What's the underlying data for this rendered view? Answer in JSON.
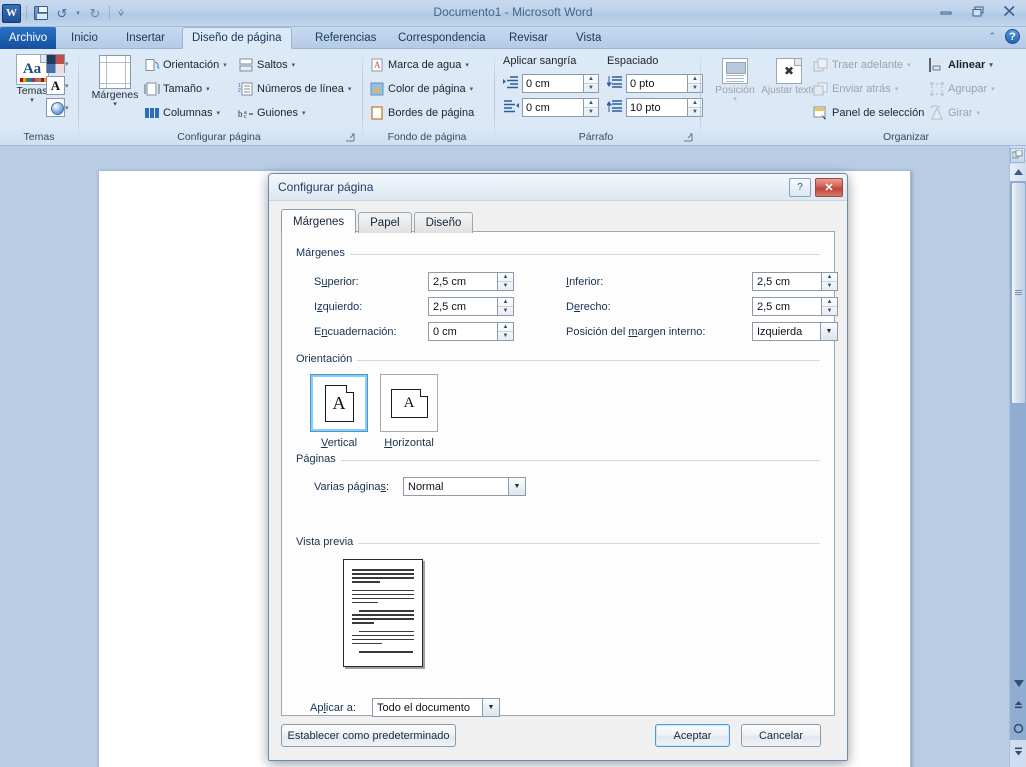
{
  "window": {
    "title": "Documento1 - Microsoft Word",
    "quick_access": {
      "word_logo": "W",
      "save": "save-icon",
      "undo": "undo-icon",
      "redo": "redo-icon",
      "customize": "customize-qat-icon"
    },
    "controls": {
      "minimize": "minimize",
      "restore": "restore",
      "close": "close"
    }
  },
  "tabs": {
    "file": "Archivo",
    "items": [
      {
        "label": "Inicio",
        "active": false
      },
      {
        "label": "Insertar",
        "active": false
      },
      {
        "label": "Diseño de página",
        "active": true
      },
      {
        "label": "Referencias",
        "active": false
      },
      {
        "label": "Correspondencia",
        "active": false
      },
      {
        "label": "Revisar",
        "active": false
      },
      {
        "label": "Vista",
        "active": false
      }
    ],
    "collapse_ribbon": "collapse-ribbon-icon",
    "help": "?"
  },
  "ribbon": {
    "groups": [
      {
        "name": "Temas",
        "label": "Temas",
        "big_button": "Temas",
        "small_buttons": [
          "Colores del tema",
          "Fuentes del tema",
          "Efectos del tema"
        ]
      },
      {
        "name": "Configurar página",
        "label": "Configurar página",
        "big_button": "Márgenes",
        "commands": [
          "Orientación",
          "Saltos",
          "Tamaño",
          "Números de línea",
          "Columnas",
          "Guiones"
        ]
      },
      {
        "name": "Fondo de página",
        "label": "Fondo de página",
        "commands": [
          "Marca de agua",
          "Color de página",
          "Bordes de página"
        ]
      },
      {
        "name": "Párrafo",
        "label": "Párrafo",
        "indent_title": "Aplicar sangría",
        "spacing_title": "Espaciado",
        "indent_left": "0 cm",
        "indent_right": "0 cm",
        "spacing_before": "0 pto",
        "spacing_after": "10 pto"
      },
      {
        "name": "Organizar",
        "label": "Organizar",
        "big_buttons": [
          "Posición",
          "Ajustar texto"
        ],
        "commands": [
          "Traer adelante",
          "Alinear",
          "Enviar atrás",
          "Agrupar",
          "Panel de selección",
          "Girar"
        ]
      }
    ]
  },
  "dialog": {
    "title": "Configurar página",
    "help_button": "?",
    "close_button": "✕",
    "tabs": [
      {
        "label": "Márgenes",
        "active": true
      },
      {
        "label": "Papel",
        "active": false
      },
      {
        "label": "Diseño",
        "active": false
      }
    ],
    "margins_group": {
      "legend": "Márgenes",
      "fields": [
        {
          "label": "Superior:",
          "value": "2,5 cm"
        },
        {
          "label": "Inferior:",
          "value": "2,5 cm"
        },
        {
          "label": "Izquierdo:",
          "value": "2,5 cm"
        },
        {
          "label": "Derecho:",
          "value": "2,5 cm"
        },
        {
          "label": "Encuadernación:",
          "value": "0 cm"
        }
      ],
      "gutter_position": {
        "label": "Posición del margen interno:",
        "value": "Izquierda"
      }
    },
    "orientation_group": {
      "legend": "Orientación",
      "options": [
        {
          "label": "Vertical",
          "selected": true
        },
        {
          "label": "Horizontal",
          "selected": false
        }
      ],
      "glyph": "A"
    },
    "pages_group": {
      "legend": "Páginas",
      "label": "Varias páginas:",
      "value": "Normal"
    },
    "preview_group": {
      "legend": "Vista previa",
      "apply_label": "Aplicar a:",
      "apply_value": "Todo el documento"
    },
    "footer": {
      "set_default": "Establecer como predeterminado",
      "ok": "Aceptar",
      "cancel": "Cancelar"
    }
  },
  "scrollbar": {
    "up": "▲",
    "down": "▼",
    "prev_page": "previous-page-icon",
    "select_browse_object": "select-browse-object-icon",
    "next_page": "next-page-icon",
    "split": "split-handle"
  },
  "colors": {
    "workspace": "#b8cce4",
    "ribbon": "#dce9f7",
    "accent": "#1f63b5",
    "close_red": "#cf5f53",
    "selection_blue": "#3c9ade"
  }
}
